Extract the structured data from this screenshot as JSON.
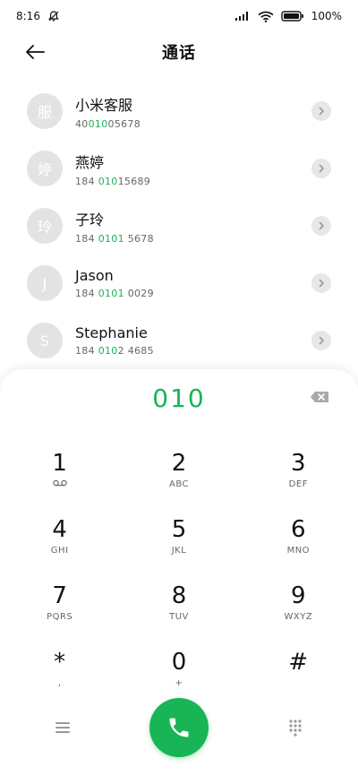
{
  "status_bar": {
    "time": "8:16",
    "battery": "100%"
  },
  "header": {
    "title": "通话"
  },
  "contacts": [
    {
      "avatar": "服",
      "name": "小米客服",
      "number_pre": "40",
      "number_hl": "010",
      "number_post": "05678"
    },
    {
      "avatar": "婷",
      "name": "燕婷",
      "number_pre": "184 ",
      "number_hl": "010",
      "number_post": "15689"
    },
    {
      "avatar": "玲",
      "name": "子玲",
      "number_pre": "184 ",
      "number_hl": "0101",
      "number_post": " 5678"
    },
    {
      "avatar": "J",
      "name": "Jason",
      "number_pre": "184 ",
      "number_hl": "0101",
      "number_post": " 0029"
    },
    {
      "avatar": "S",
      "name": "Stephanie",
      "number_pre": "184 ",
      "number_hl": "010",
      "number_post": "2 4685"
    }
  ],
  "dialpad": {
    "dialed": "010",
    "keys": [
      {
        "digit": "1",
        "letters": ""
      },
      {
        "digit": "2",
        "letters": "ABC"
      },
      {
        "digit": "3",
        "letters": "DEF"
      },
      {
        "digit": "4",
        "letters": "GHI"
      },
      {
        "digit": "5",
        "letters": "JKL"
      },
      {
        "digit": "6",
        "letters": "MNO"
      },
      {
        "digit": "7",
        "letters": "PQRS"
      },
      {
        "digit": "8",
        "letters": "TUV"
      },
      {
        "digit": "9",
        "letters": "WXYZ"
      },
      {
        "digit": "*",
        "letters": ","
      },
      {
        "digit": "0",
        "letters": "+"
      },
      {
        "digit": "#",
        "letters": ""
      }
    ]
  },
  "colors": {
    "accent": "#19b456",
    "avatar_bg": "#e3e3e3"
  },
  "icons": {
    "status_left": [
      "bell-off-icon"
    ],
    "status_right": [
      "signal-icon",
      "wifi-icon",
      "battery-icon"
    ],
    "header": "back-arrow-icon",
    "list_row": "chevron-right-icon",
    "dialpad": [
      "backspace-icon",
      "voicemail-icon",
      "menu-icon",
      "phone-icon",
      "keypad-grid-icon"
    ]
  }
}
